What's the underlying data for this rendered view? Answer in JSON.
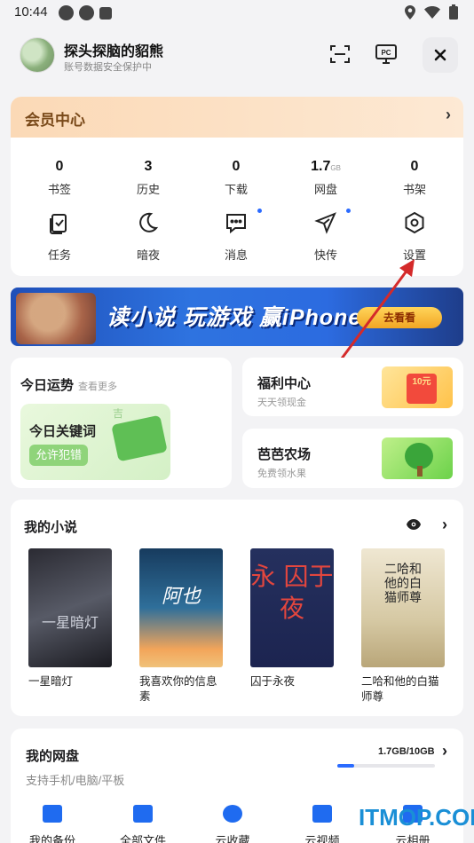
{
  "status_bar": {
    "time": "10:44"
  },
  "header": {
    "username": "探头探脑的貂熊",
    "subtitle": "账号数据安全保护中",
    "pc_label": "PC"
  },
  "member": {
    "title": "会员中心",
    "stats": [
      {
        "value": "0",
        "unit": "",
        "label": "书签"
      },
      {
        "value": "3",
        "unit": "",
        "label": "历史"
      },
      {
        "value": "0",
        "unit": "",
        "label": "下载"
      },
      {
        "value": "1.7",
        "unit": "GB",
        "label": "网盘"
      },
      {
        "value": "0",
        "unit": "",
        "label": "书架"
      }
    ],
    "tools": [
      {
        "label": "任务",
        "icon": "task-check-icon",
        "dot": false
      },
      {
        "label": "暗夜",
        "icon": "moon-icon",
        "dot": false
      },
      {
        "label": "消息",
        "icon": "message-icon",
        "dot": true
      },
      {
        "label": "快传",
        "icon": "send-icon",
        "dot": true
      },
      {
        "label": "设置",
        "icon": "settings-icon",
        "dot": false
      }
    ]
  },
  "banner": {
    "text": "读小说 玩游戏 赢iPhone",
    "button": "去看看"
  },
  "fortune": {
    "title": "今日运势",
    "more": "查看更多",
    "keyword_title": "今日关键词",
    "keyword_button": "允许犯错",
    "deco_char": "吉"
  },
  "welfare": {
    "title": "福利中心",
    "subtitle": "天天领现金",
    "badge": "10元"
  },
  "farm": {
    "title": "芭芭农场",
    "subtitle": "免费领水果"
  },
  "novels": {
    "title": "我的小说",
    "books": [
      {
        "name": "一星暗灯",
        "cover_text": "一星暗灯"
      },
      {
        "name": "我喜欢你的信息素",
        "cover_text": "阿也"
      },
      {
        "name": "囚于永夜",
        "cover_text": "永 囚于 夜"
      },
      {
        "name": "二哈和他的白猫师尊",
        "cover_text": "二哈和他的白猫师尊"
      }
    ]
  },
  "disk": {
    "title": "我的网盘",
    "subtitle": "支持手机/电脑/平板",
    "usage": "1.7GB/10GB",
    "usage_fraction": 0.17,
    "items": [
      {
        "label": "我的备份",
        "icon": "backup-icon"
      },
      {
        "label": "全部文件",
        "icon": "files-icon"
      },
      {
        "label": "云收藏",
        "icon": "cloud-icon"
      },
      {
        "label": "云视频",
        "icon": "video-icon"
      },
      {
        "label": "云相册",
        "icon": "album-icon"
      }
    ]
  },
  "watermark": "ITMOP.COM",
  "colors": {
    "accent": "#2b6bff",
    "member_text": "#7a4a1a",
    "annotation_arrow": "#d42a2a"
  }
}
